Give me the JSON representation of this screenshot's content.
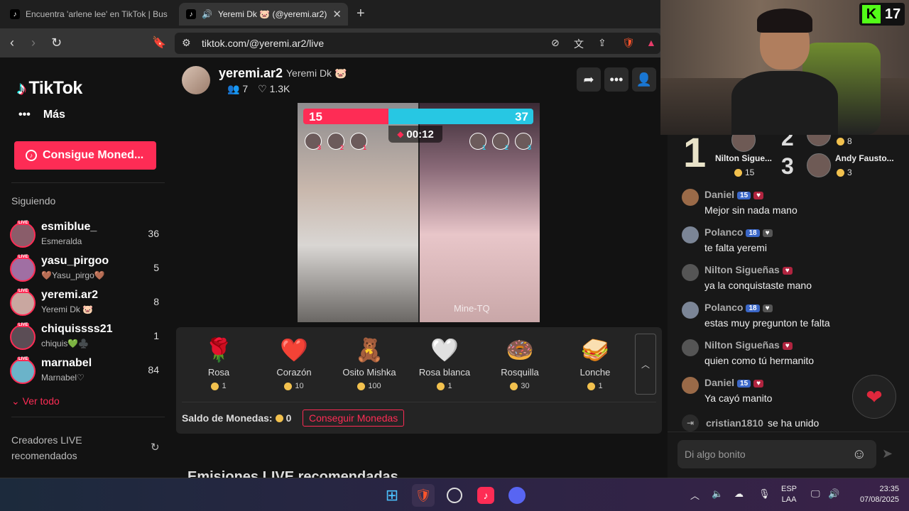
{
  "browser": {
    "tabs": [
      {
        "title": "Encuentra 'arlene lee' en TikTok | Bus",
        "active": false
      },
      {
        "title": "Yeremi Dk 🐷 (@yeremi.ar2)",
        "active": true
      }
    ],
    "url": "tiktok.com/@yeremi.ar2/live",
    "new_tab_icon": "plus-icon"
  },
  "sidebar": {
    "logo": "TikTok",
    "more_label": "Más",
    "coins_button": "Consigue Moned...",
    "following_title": "Siguiendo",
    "following": [
      {
        "name": "esmiblue_",
        "sub": "Esmeralda",
        "count": "36"
      },
      {
        "name": "yasu_pirgoo",
        "sub": "🤎Yasu_pirgo🤎",
        "count": "5"
      },
      {
        "name": "yeremi.ar2",
        "sub": "Yeremi Dk 🐷",
        "count": "8"
      },
      {
        "name": "chiquissss21",
        "sub": "chiquis💚♣️",
        "count": "1"
      },
      {
        "name": "marnabel",
        "sub": "Marnabel♡",
        "count": "84"
      }
    ],
    "live_badge": "LIVE",
    "see_all": "Ver todo",
    "creators_title": "Creadores LIVE recomendados"
  },
  "host": {
    "username": "yeremi.ar2",
    "nickname": "Yeremi Dk 🐷",
    "viewers": "7",
    "likes": "1.3K"
  },
  "battle": {
    "left_score": "15",
    "right_score": "37",
    "timer": "00:12",
    "left_supporters": [
      "3",
      "2",
      "1"
    ],
    "right_supporters": [
      "1",
      "2",
      "3"
    ],
    "watermark": "Mine-TQ"
  },
  "gifts": [
    {
      "name": "Rosa",
      "icon": "🌹",
      "price": "1"
    },
    {
      "name": "Corazón",
      "icon": "❤️",
      "price": "10"
    },
    {
      "name": "Osito Mishka",
      "icon": "🧸",
      "price": "100"
    },
    {
      "name": "Rosa blanca",
      "icon": "🤍",
      "price": "1"
    },
    {
      "name": "Rosquilla",
      "icon": "🍩",
      "price": "30"
    },
    {
      "name": "Lonche",
      "icon": "🥪",
      "price": "1"
    }
  ],
  "wallet": {
    "balance_label": "Saldo de Monedas:",
    "balance": "0",
    "get_coins": "Conseguir Monedas"
  },
  "recommended_title": "Emisiones LIVE recomendadas",
  "ranking": [
    {
      "rank": "1",
      "name": "Nilton Sigue...",
      "coins": "15"
    },
    {
      "rank": "2",
      "name": "",
      "coins": "8"
    },
    {
      "rank": "3",
      "name": "Andy Fausto...",
      "coins": "3"
    }
  ],
  "chat": {
    "messages": [
      {
        "user": "Daniel",
        "level": "15",
        "text": "Mejor sin nada mano"
      },
      {
        "user": "Polanco",
        "level": "18",
        "text": "te falta yeremi"
      },
      {
        "user": "Nilton Sigueñas",
        "level": "",
        "text": "ya la conquistaste mano"
      },
      {
        "user": "Polanco",
        "level": "18",
        "text": "estas muy pregunton te falta"
      },
      {
        "user": "Nilton Sigueñas",
        "level": "",
        "text": "quien como tú hermanito"
      },
      {
        "user": "Daniel",
        "level": "15",
        "text": "Ya cayó manito"
      }
    ],
    "joined_user": "cristian1810",
    "joined_text": "se ha unido",
    "input_placeholder": "Di algo bonito"
  },
  "webcam": {
    "kick_count": "17"
  },
  "taskbar": {
    "lang_top": "ESP",
    "lang_bottom": "LAA",
    "time": "23:35",
    "date": "07/08/2025"
  }
}
